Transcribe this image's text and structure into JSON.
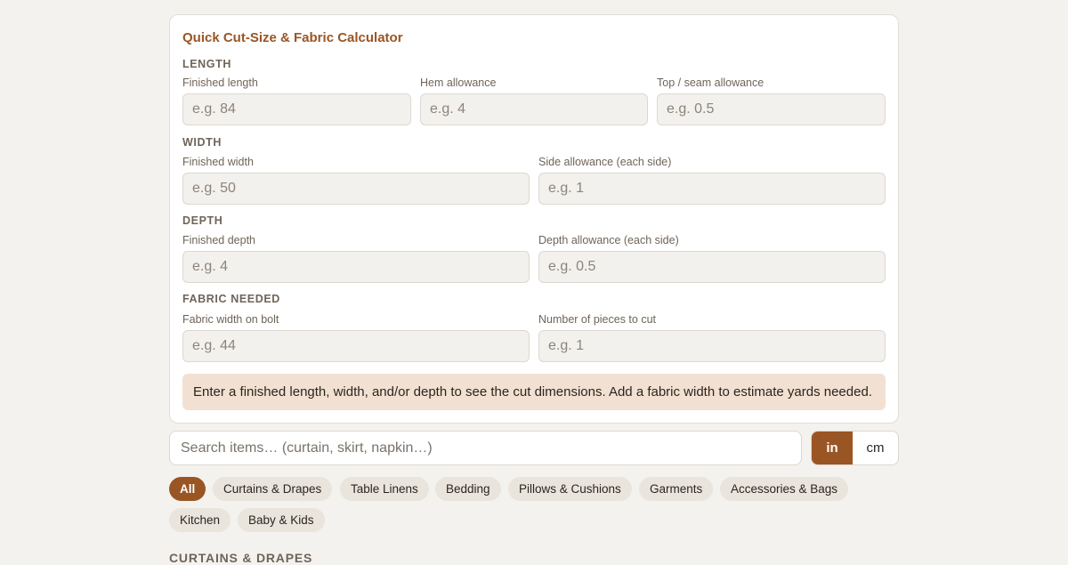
{
  "calculator": {
    "title": "Quick Cut-Size & Fabric Calculator",
    "sections": {
      "length": "LENGTH",
      "width": "WIDTH",
      "depth": "DEPTH",
      "fabric": "FABRIC NEEDED"
    },
    "fields": {
      "finished_length": {
        "label": "Finished length",
        "placeholder": "e.g. 84",
        "value": ""
      },
      "hem_allowance": {
        "label": "Hem allowance",
        "placeholder": "e.g. 4",
        "value": ""
      },
      "top_seam_allowance": {
        "label": "Top / seam allowance",
        "placeholder": "e.g. 0.5",
        "value": ""
      },
      "finished_width": {
        "label": "Finished width",
        "placeholder": "e.g. 50",
        "value": ""
      },
      "side_allowance": {
        "label": "Side allowance (each side)",
        "placeholder": "e.g. 1",
        "value": ""
      },
      "finished_depth": {
        "label": "Finished depth",
        "placeholder": "e.g. 4",
        "value": ""
      },
      "depth_allowance": {
        "label": "Depth allowance (each side)",
        "placeholder": "e.g. 0.5",
        "value": ""
      },
      "fabric_width": {
        "label": "Fabric width on bolt",
        "placeholder": "e.g. 44",
        "value": ""
      },
      "pieces": {
        "label": "Number of pieces to cut",
        "placeholder": "e.g. 1",
        "value": ""
      }
    },
    "result_text": "Enter a finished length, width, and/or depth to see the cut dimensions. Add a fabric width to estimate yards needed."
  },
  "search": {
    "placeholder": "Search items… (curtain, skirt, napkin…)",
    "value": ""
  },
  "units": {
    "in": "in",
    "cm": "cm",
    "selected": "in"
  },
  "filters": [
    {
      "label": "All",
      "active": true
    },
    {
      "label": "Curtains & Drapes",
      "active": false
    },
    {
      "label": "Table Linens",
      "active": false
    },
    {
      "label": "Bedding",
      "active": false
    },
    {
      "label": "Pillows & Cushions",
      "active": false
    },
    {
      "label": "Garments",
      "active": false
    },
    {
      "label": "Accessories & Bags",
      "active": false
    },
    {
      "label": "Kitchen",
      "active": false
    },
    {
      "label": "Baby & Kids",
      "active": false
    }
  ],
  "category_heading": "CURTAINS & DRAPES",
  "colors": {
    "accent": "#9a5524",
    "background": "#f4f2ee",
    "result_bg": "#f2e1d2",
    "chip_bg": "#e9e4dc"
  }
}
